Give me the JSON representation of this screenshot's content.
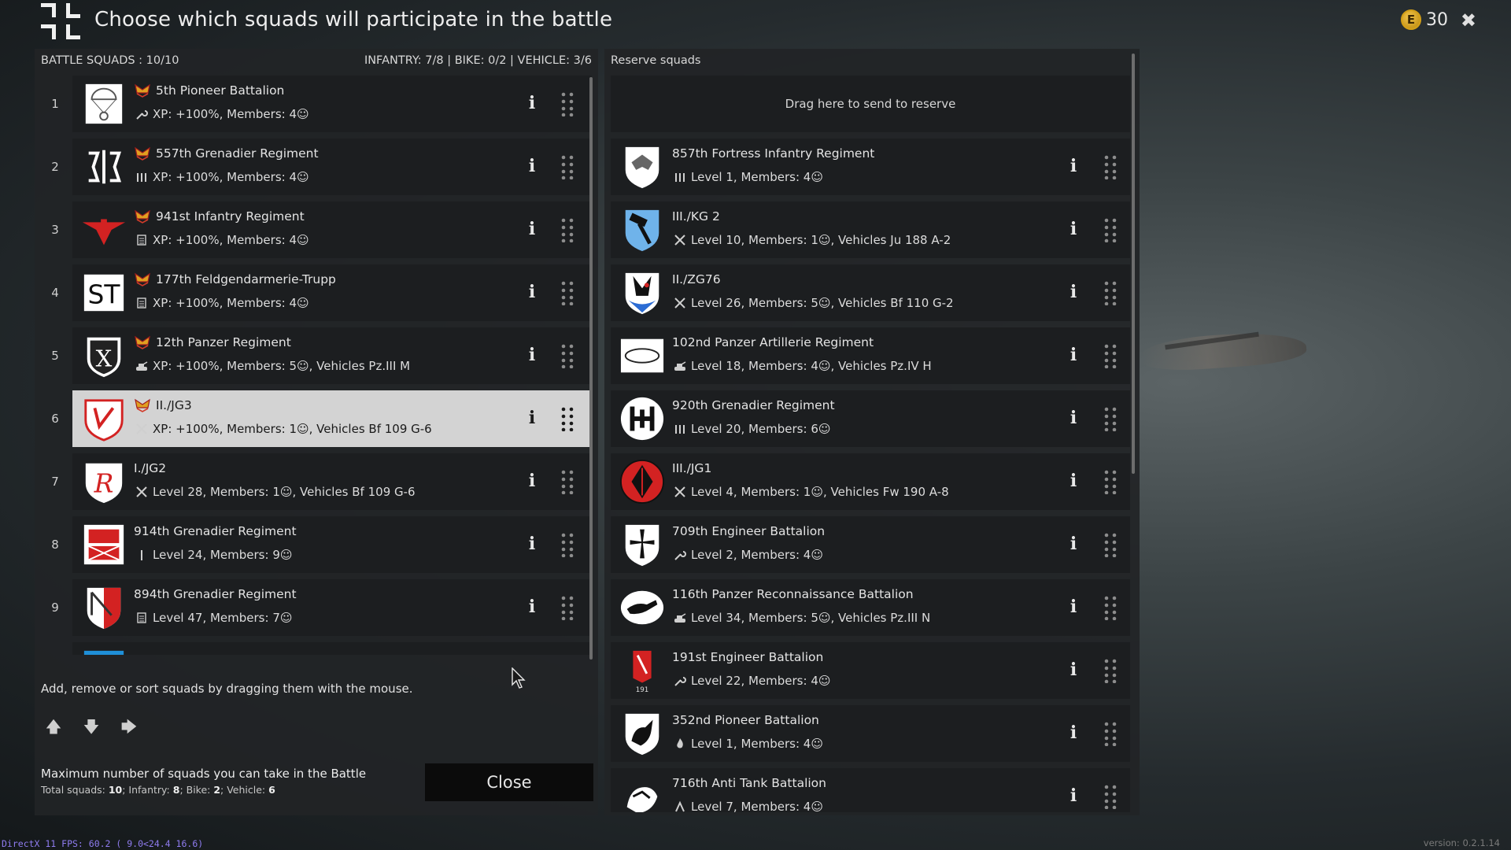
{
  "title": "Choose which squads will participate in the battle",
  "currency": {
    "symbol": "E",
    "value": "30"
  },
  "battle": {
    "header_left": "BATTLE SQUADS : 10/10",
    "header_right": "INFANTRY: 7/8 | BIKE: 0/2 | VEHICLE: 3/6",
    "squads": [
      {
        "num": "1",
        "name": "5th Pioneer Battalion",
        "info": "XP: +100%, Members: 4☺",
        "type_icon": "wrench-icon",
        "emblem": "parachute-emblem",
        "premium": true
      },
      {
        "num": "2",
        "name": "557th Grenadier Regiment",
        "info": "XP: +100%, Members: 4☺",
        "type_icon": "rifles-icon",
        "emblem": "rune-emblem",
        "premium": true
      },
      {
        "num": "3",
        "name": "941st Infantry Regiment",
        "info": "XP: +100%, Members: 4☺",
        "type_icon": "document-icon",
        "emblem": "red-wings-emblem",
        "premium": true
      },
      {
        "num": "4",
        "name": "177th Feldgendarmerie-Trupp",
        "info": "XP: +100%, Members: 4☺",
        "type_icon": "document-icon",
        "emblem": "st-emblem",
        "premium": true
      },
      {
        "num": "5",
        "name": "12th Panzer Regiment",
        "info": "XP: +100%, Members: 5☺, Vehicles Pz.III M",
        "type_icon": "tank-icon",
        "emblem": "x-shield-emblem",
        "premium": true
      },
      {
        "num": "6",
        "name": "II./JG3",
        "info": "XP: +100%, Members: 1☺, Vehicles Bf 109 G-6",
        "type_icon": "plane-icon",
        "emblem": "red-u-shield-emblem",
        "premium": true,
        "selected": true
      },
      {
        "num": "7",
        "name": "I./JG2",
        "info": "Level 28, Members: 1☺, Vehicles Bf 109 G-6",
        "type_icon": "plane-icon",
        "emblem": "r-shield-emblem",
        "premium": false
      },
      {
        "num": "8",
        "name": "914th Grenadier Regiment",
        "info": "Level 24, Members: 9☺",
        "type_icon": "rifle-icon",
        "emblem": "red-bear-emblem",
        "premium": false
      },
      {
        "num": "9",
        "name": "894th Grenadier Regiment",
        "info": "Level 47, Members: 7☺",
        "type_icon": "document-icon",
        "emblem": "red-white-shield-emblem",
        "premium": false
      }
    ]
  },
  "hint": "Add, remove or sort squads by dragging them with the mouse.",
  "max": {
    "title": "Maximum number of squads you can take in the Battle",
    "l_total": "Total squads: ",
    "v_total": "10",
    "l_inf": "; Infantry: ",
    "v_inf": "8",
    "l_bike": "; Bike: ",
    "v_bike": "2",
    "l_veh": "; Vehicle: ",
    "v_veh": "6"
  },
  "close_label": "Close",
  "reserve": {
    "header": "Reserve squads",
    "dropzone": "Drag here to send to reserve",
    "squads": [
      {
        "name": "857th Fortress Infantry Regiment",
        "info": "Level 1, Members: 4☺",
        "type_icon": "rifles-icon",
        "emblem": "eagle-shield-emblem"
      },
      {
        "name": "III./KG 2",
        "info": "Level 10, Members: 1☺, Vehicles Ju 188 A-2",
        "type_icon": "plane-icon",
        "emblem": "hammer-shield-emblem"
      },
      {
        "name": "II./ZG76",
        "info": "Level 26, Members: 5☺, Vehicles Bf 110 G-2",
        "type_icon": "plane-icon",
        "emblem": "eagle-blue-shield-emblem"
      },
      {
        "name": "102nd Panzer Artillerie Regiment",
        "info": "Level 18, Members: 4☺, Vehicles Pz.IV H",
        "type_icon": "tank-icon",
        "emblem": "oval-emblem"
      },
      {
        "name": "920th Grenadier Regiment",
        "info": "Level 20, Members: 6☺",
        "type_icon": "rifles-icon",
        "emblem": "h-circle-emblem"
      },
      {
        "name": "III./JG1",
        "info": "Level 4, Members: 1☺, Vehicles Fw 190 A-8",
        "type_icon": "plane-icon",
        "emblem": "red-circle-emblem"
      },
      {
        "name": "709th Engineer Battalion",
        "info": "Level 2, Members: 4☺",
        "type_icon": "wrench-icon",
        "emblem": "cross-shield-emblem"
      },
      {
        "name": "116th Panzer Reconnaissance Battalion",
        "info": "Level 34, Members: 5☺, Vehicles Pz.III N",
        "type_icon": "tank-icon",
        "emblem": "greyhound-emblem"
      },
      {
        "name": "191st Engineer Battalion",
        "info": "Level 22, Members: 4☺",
        "type_icon": "wrench-icon",
        "emblem": "red-pennant-emblem"
      },
      {
        "name": "352nd Pioneer Battalion",
        "info": "Level 1, Members: 4☺",
        "type_icon": "flame-icon",
        "emblem": "pegasus-emblem"
      },
      {
        "name": "716th Anti Tank Battalion",
        "info": "Level 7, Members: 4☺",
        "type_icon": "anti-tank-icon",
        "emblem": "lion-emblem"
      }
    ]
  },
  "status": {
    "fps": "DirectX 11 FPS: 60.2 ( 9.0<24.4 16.6)",
    "version": "version: 0.2.1.14"
  }
}
